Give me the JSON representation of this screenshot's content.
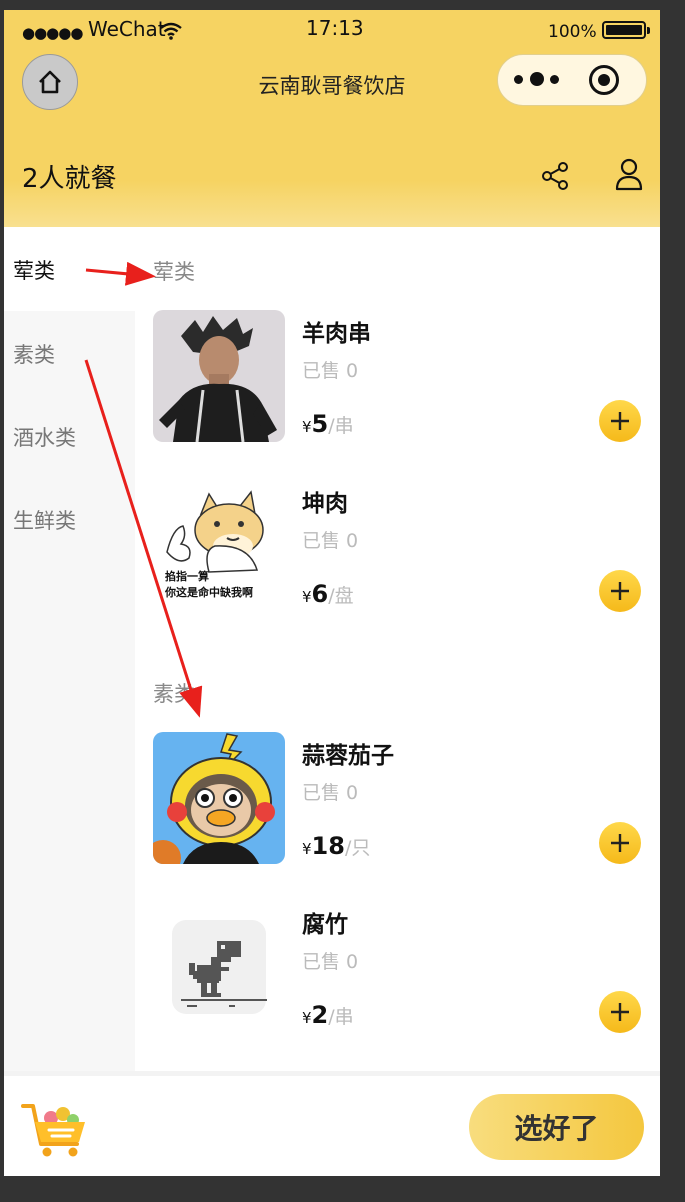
{
  "status_bar": {
    "carrier": "WeChat",
    "time": "17:13",
    "battery": "100%",
    "battery_level": 1.0
  },
  "navbar": {
    "title": "云南耿哥餐饮店",
    "icons": [
      "home-icon",
      "more-icon",
      "target-icon"
    ]
  },
  "header": {
    "party_size": "2人就餐",
    "icons": [
      "share-icon",
      "user-icon"
    ]
  },
  "sidebar": {
    "items": [
      {
        "label": "荤类",
        "active": true
      },
      {
        "label": "素类",
        "active": false
      },
      {
        "label": "酒水类",
        "active": false
      },
      {
        "label": "生鲜类",
        "active": false
      }
    ]
  },
  "sections": [
    {
      "title": "荤类",
      "dishes": [
        {
          "name": "羊肉串",
          "sold": "已售 0",
          "currency": "¥",
          "price": "5",
          "unit": "/串",
          "image": "meme-photo"
        },
        {
          "name": "坤肉",
          "sold": "已售 0",
          "currency": "¥",
          "price": "6",
          "unit": "/盘",
          "image": "shiba-meme",
          "image_caption": [
            "掐指一算",
            "你这是命中缺我啊"
          ]
        }
      ]
    },
    {
      "title": "素类",
      "dishes": [
        {
          "name": "蒜蓉茄子",
          "sold": "已售 0",
          "currency": "¥",
          "price": "18",
          "unit": "/只",
          "image": "pikachu-duck-meme"
        },
        {
          "name": "腐竹",
          "sold": "已售 0",
          "currency": "¥",
          "price": "2",
          "unit": "/串",
          "image": "dino-icon"
        }
      ]
    }
  ],
  "bottom_bar": {
    "cart_icon": "cart-icon",
    "submit_label": "选好了"
  },
  "colors": {
    "theme_yellow": "#f6d362",
    "add_button": "#f5b91a",
    "annotation_arrow": "#e8201c"
  }
}
